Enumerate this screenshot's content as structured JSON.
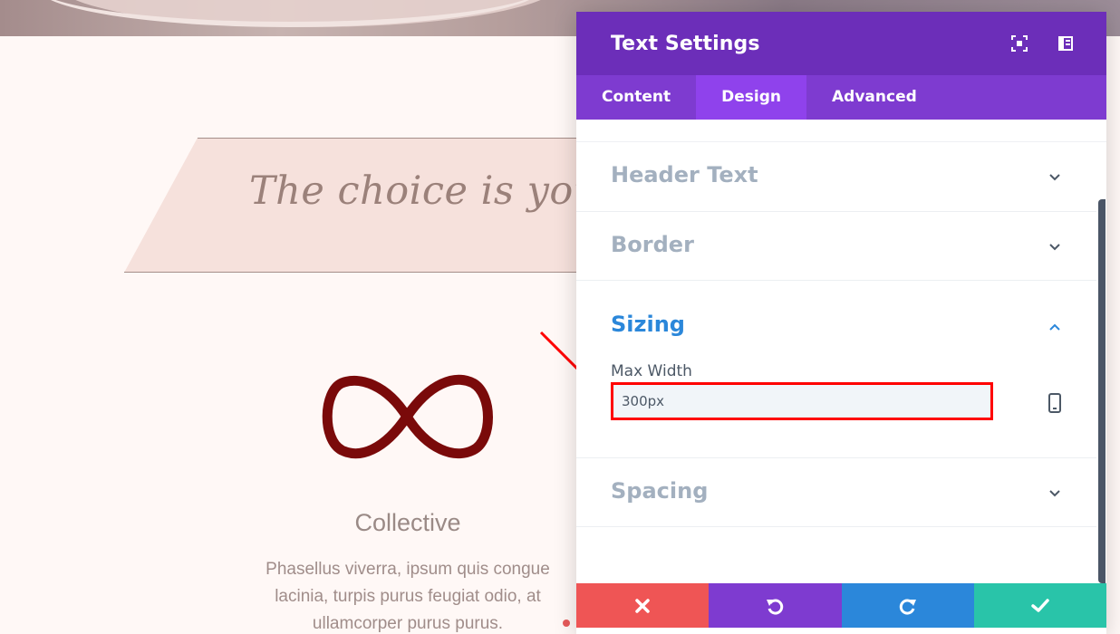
{
  "background": {
    "banner_text": "The choice is yours",
    "feature_title": "Collective",
    "feature_text": "Phasellus viverra, ipsum quis congue lacinia, turpis purus feugiat odio, at ullamcorper purus purus."
  },
  "modal": {
    "title": "Text Settings",
    "tabs": [
      {
        "label": "Content",
        "active": false
      },
      {
        "label": "Design",
        "active": true
      },
      {
        "label": "Advanced",
        "active": false
      }
    ],
    "sections": [
      {
        "title": "Header Text",
        "expanded": false
      },
      {
        "title": "Border",
        "expanded": false
      },
      {
        "title": "Sizing",
        "expanded": true
      },
      {
        "title": "Spacing",
        "expanded": false
      }
    ],
    "sizing": {
      "max_width_label": "Max Width",
      "max_width_value": "300px"
    },
    "footer": [
      "cancel-icon",
      "undo-icon",
      "redo-icon",
      "save-check-icon"
    ]
  },
  "colors": {
    "header_purple": "#6c2eb9",
    "tab_purple": "#7e3bd0",
    "active_tab": "#8f42ec",
    "section_open_blue": "#2b87da",
    "cancel_red": "#ef5555",
    "save_green": "#29c4a9",
    "highlight_red": "#ff0000"
  }
}
